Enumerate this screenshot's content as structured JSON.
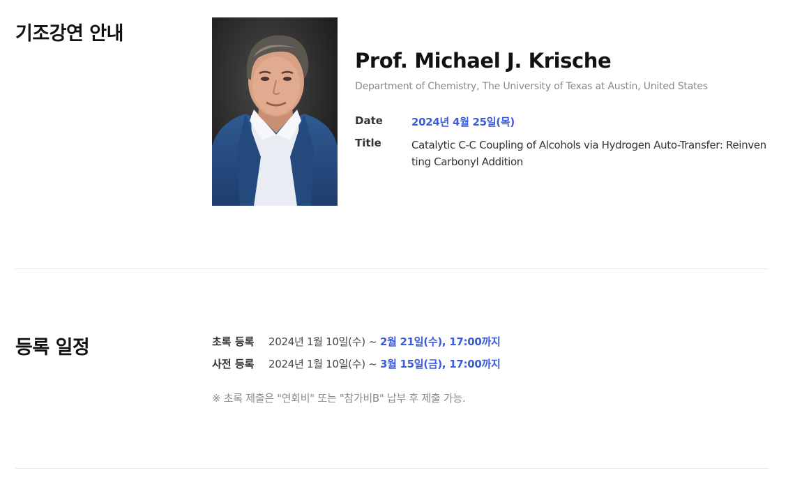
{
  "keynote": {
    "section_title": "기조강연 안내",
    "speaker_name": "Prof. Michael J. Krische",
    "affiliation": "Department of Chemistry, The University of Texas at Austin, United States",
    "date_label": "Date",
    "date_value": "2024년 4월 25일(목)",
    "title_label": "Title",
    "title_value": "Catalytic C-C Coupling of Alcohols via Hydrogen Auto-Transfer: Reinventing Carbonyl Addition"
  },
  "registration": {
    "section_title": "등록 일정",
    "rows": [
      {
        "label": "초록 등록",
        "start": "2024년 1월 10일(수) ~ ",
        "deadline": "2월 21일(수), 17:00까지"
      },
      {
        "label": "사전 등록",
        "start": "2024년 1월 10일(수) ~ ",
        "deadline": "3월 15일(금), 17:00까지"
      }
    ],
    "note": "※ 초록 제출은 \"연회비\" 또는 \"참가비B\" 납부 후 제출 가능."
  },
  "colors": {
    "accent": "#3b5bdb",
    "muted": "#8a8a8a",
    "divider": "#e6e6e6"
  }
}
